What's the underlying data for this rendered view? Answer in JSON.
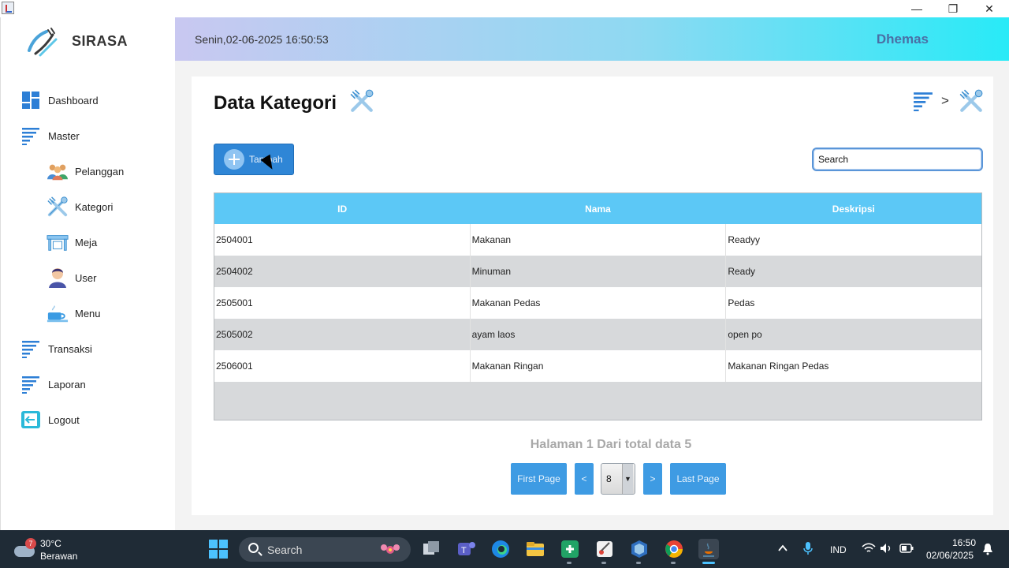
{
  "window": {
    "minimize": "—",
    "maximize": "❐",
    "close": "✕"
  },
  "sidebar": {
    "brand": "SIRASA",
    "items": [
      {
        "label": "Dashboard",
        "icon": "dashboard-icon"
      },
      {
        "label": "Master",
        "icon": "list-icon"
      },
      {
        "label": "Pelanggan",
        "icon": "customers-icon"
      },
      {
        "label": "Kategori",
        "icon": "utensils-icon"
      },
      {
        "label": "Meja",
        "icon": "table-icon"
      },
      {
        "label": "User",
        "icon": "user-icon"
      },
      {
        "label": "Menu",
        "icon": "dish-icon"
      },
      {
        "label": "Transaksi",
        "icon": "list-icon"
      },
      {
        "label": "Laporan",
        "icon": "list-icon"
      },
      {
        "label": "Logout",
        "icon": "logout-icon"
      }
    ]
  },
  "header": {
    "datetime": "Senin,02-06-2025 16:50:53",
    "username": "Dhemas"
  },
  "page": {
    "title": "Data Kategori",
    "breadcrumb_sep": ">",
    "add_label": "Tambah",
    "search_placeholder": "Search"
  },
  "table": {
    "columns": [
      "ID",
      "Nama",
      "Deskripsi"
    ],
    "rows": [
      [
        "2504001",
        "Makanan",
        "Readyy"
      ],
      [
        "2504002",
        "Minuman",
        "Ready"
      ],
      [
        "2505001",
        "Makanan Pedas",
        "Pedas"
      ],
      [
        "2505002",
        "ayam laos",
        "open po"
      ],
      [
        "2506001",
        "Makanan Ringan",
        "Makanan Ringan Pedas"
      ]
    ]
  },
  "pagination": {
    "info": "Halaman 1 Dari total data 5",
    "first": "First Page",
    "prev": "<",
    "page_size": "8",
    "next": ">",
    "last": "Last Page"
  },
  "taskbar": {
    "weather_badge": "7",
    "temperature": "30°C",
    "condition": "Berawan",
    "search_label": "Search",
    "language": "IND",
    "time": "16:50",
    "date": "02/06/2025"
  },
  "colors": {
    "header_gradient_start": "#c9c8f1",
    "header_gradient_end": "#28eaf7",
    "table_header": "#5cc8f6",
    "button_blue": "#2f86d6",
    "pager_blue": "#3e9be3"
  }
}
